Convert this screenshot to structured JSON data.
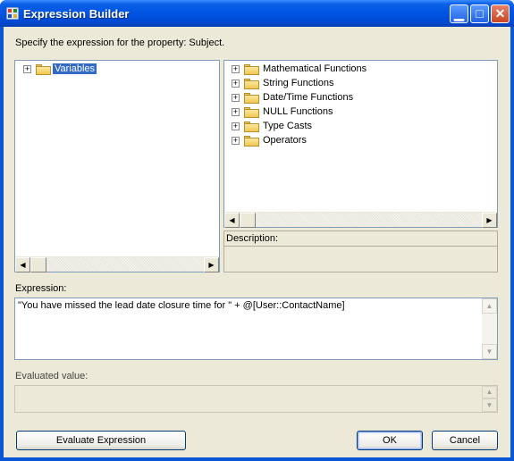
{
  "window": {
    "title": "Expression Builder",
    "icons": {
      "app": "expression-builder-icon",
      "minimize": "minimize-icon",
      "maximize": "maximize-icon",
      "close": "close-icon"
    }
  },
  "instruction": "Specify the expression for the property: Subject.",
  "variables_tree": {
    "items": [
      {
        "label": "Variables",
        "icon": "folder-open-icon",
        "selected": true
      }
    ]
  },
  "functions_tree": {
    "items": [
      {
        "label": "Mathematical Functions",
        "icon": "folder-icon"
      },
      {
        "label": "String Functions",
        "icon": "folder-icon"
      },
      {
        "label": "Date/Time Functions",
        "icon": "folder-icon"
      },
      {
        "label": "NULL Functions",
        "icon": "folder-icon"
      },
      {
        "label": "Type Casts",
        "icon": "folder-icon"
      },
      {
        "label": "Operators",
        "icon": "folder-icon"
      }
    ]
  },
  "description": {
    "label": "Description:"
  },
  "expression": {
    "label": "Expression:",
    "value": "\"You have missed the lead date closure time for \" +  @[User::ContactName]"
  },
  "evaluated": {
    "label": "Evaluated value:",
    "value": ""
  },
  "buttons": {
    "evaluate": "Evaluate Expression",
    "ok": "OK",
    "cancel": "Cancel"
  },
  "colors": {
    "titlebar": "#0054e3",
    "selection": "#316ac5",
    "dialog_bg": "#ece9d8",
    "border": "#7f9db9"
  }
}
